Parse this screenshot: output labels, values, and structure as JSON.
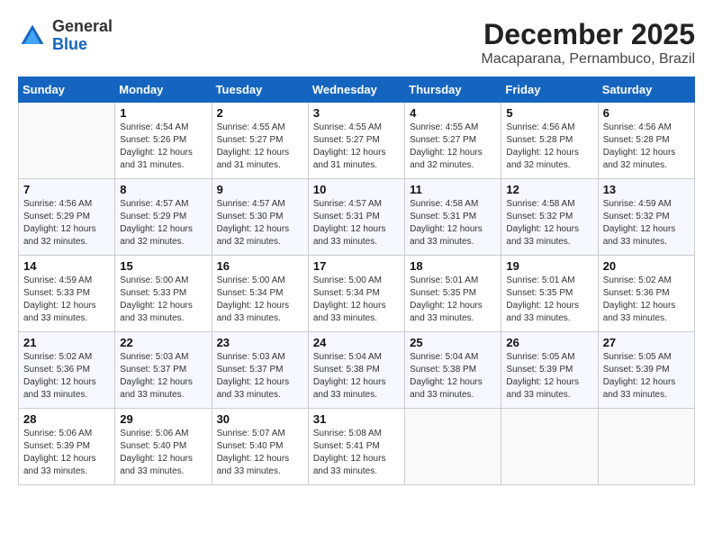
{
  "header": {
    "logo_general": "General",
    "logo_blue": "Blue",
    "main_title": "December 2025",
    "subtitle": "Macaparana, Pernambuco, Brazil"
  },
  "calendar": {
    "days_of_week": [
      "Sunday",
      "Monday",
      "Tuesday",
      "Wednesday",
      "Thursday",
      "Friday",
      "Saturday"
    ],
    "weeks": [
      [
        {
          "day": "",
          "info": ""
        },
        {
          "day": "1",
          "info": "Sunrise: 4:54 AM\nSunset: 5:26 PM\nDaylight: 12 hours\nand 31 minutes."
        },
        {
          "day": "2",
          "info": "Sunrise: 4:55 AM\nSunset: 5:27 PM\nDaylight: 12 hours\nand 31 minutes."
        },
        {
          "day": "3",
          "info": "Sunrise: 4:55 AM\nSunset: 5:27 PM\nDaylight: 12 hours\nand 31 minutes."
        },
        {
          "day": "4",
          "info": "Sunrise: 4:55 AM\nSunset: 5:27 PM\nDaylight: 12 hours\nand 32 minutes."
        },
        {
          "day": "5",
          "info": "Sunrise: 4:56 AM\nSunset: 5:28 PM\nDaylight: 12 hours\nand 32 minutes."
        },
        {
          "day": "6",
          "info": "Sunrise: 4:56 AM\nSunset: 5:28 PM\nDaylight: 12 hours\nand 32 minutes."
        }
      ],
      [
        {
          "day": "7",
          "info": "Sunrise: 4:56 AM\nSunset: 5:29 PM\nDaylight: 12 hours\nand 32 minutes."
        },
        {
          "day": "8",
          "info": "Sunrise: 4:57 AM\nSunset: 5:29 PM\nDaylight: 12 hours\nand 32 minutes."
        },
        {
          "day": "9",
          "info": "Sunrise: 4:57 AM\nSunset: 5:30 PM\nDaylight: 12 hours\nand 32 minutes."
        },
        {
          "day": "10",
          "info": "Sunrise: 4:57 AM\nSunset: 5:31 PM\nDaylight: 12 hours\nand 33 minutes."
        },
        {
          "day": "11",
          "info": "Sunrise: 4:58 AM\nSunset: 5:31 PM\nDaylight: 12 hours\nand 33 minutes."
        },
        {
          "day": "12",
          "info": "Sunrise: 4:58 AM\nSunset: 5:32 PM\nDaylight: 12 hours\nand 33 minutes."
        },
        {
          "day": "13",
          "info": "Sunrise: 4:59 AM\nSunset: 5:32 PM\nDaylight: 12 hours\nand 33 minutes."
        }
      ],
      [
        {
          "day": "14",
          "info": "Sunrise: 4:59 AM\nSunset: 5:33 PM\nDaylight: 12 hours\nand 33 minutes."
        },
        {
          "day": "15",
          "info": "Sunrise: 5:00 AM\nSunset: 5:33 PM\nDaylight: 12 hours\nand 33 minutes."
        },
        {
          "day": "16",
          "info": "Sunrise: 5:00 AM\nSunset: 5:34 PM\nDaylight: 12 hours\nand 33 minutes."
        },
        {
          "day": "17",
          "info": "Sunrise: 5:00 AM\nSunset: 5:34 PM\nDaylight: 12 hours\nand 33 minutes."
        },
        {
          "day": "18",
          "info": "Sunrise: 5:01 AM\nSunset: 5:35 PM\nDaylight: 12 hours\nand 33 minutes."
        },
        {
          "day": "19",
          "info": "Sunrise: 5:01 AM\nSunset: 5:35 PM\nDaylight: 12 hours\nand 33 minutes."
        },
        {
          "day": "20",
          "info": "Sunrise: 5:02 AM\nSunset: 5:36 PM\nDaylight: 12 hours\nand 33 minutes."
        }
      ],
      [
        {
          "day": "21",
          "info": "Sunrise: 5:02 AM\nSunset: 5:36 PM\nDaylight: 12 hours\nand 33 minutes."
        },
        {
          "day": "22",
          "info": "Sunrise: 5:03 AM\nSunset: 5:37 PM\nDaylight: 12 hours\nand 33 minutes."
        },
        {
          "day": "23",
          "info": "Sunrise: 5:03 AM\nSunset: 5:37 PM\nDaylight: 12 hours\nand 33 minutes."
        },
        {
          "day": "24",
          "info": "Sunrise: 5:04 AM\nSunset: 5:38 PM\nDaylight: 12 hours\nand 33 minutes."
        },
        {
          "day": "25",
          "info": "Sunrise: 5:04 AM\nSunset: 5:38 PM\nDaylight: 12 hours\nand 33 minutes."
        },
        {
          "day": "26",
          "info": "Sunrise: 5:05 AM\nSunset: 5:39 PM\nDaylight: 12 hours\nand 33 minutes."
        },
        {
          "day": "27",
          "info": "Sunrise: 5:05 AM\nSunset: 5:39 PM\nDaylight: 12 hours\nand 33 minutes."
        }
      ],
      [
        {
          "day": "28",
          "info": "Sunrise: 5:06 AM\nSunset: 5:39 PM\nDaylight: 12 hours\nand 33 minutes."
        },
        {
          "day": "29",
          "info": "Sunrise: 5:06 AM\nSunset: 5:40 PM\nDaylight: 12 hours\nand 33 minutes."
        },
        {
          "day": "30",
          "info": "Sunrise: 5:07 AM\nSunset: 5:40 PM\nDaylight: 12 hours\nand 33 minutes."
        },
        {
          "day": "31",
          "info": "Sunrise: 5:08 AM\nSunset: 5:41 PM\nDaylight: 12 hours\nand 33 minutes."
        },
        {
          "day": "",
          "info": ""
        },
        {
          "day": "",
          "info": ""
        },
        {
          "day": "",
          "info": ""
        }
      ]
    ]
  }
}
